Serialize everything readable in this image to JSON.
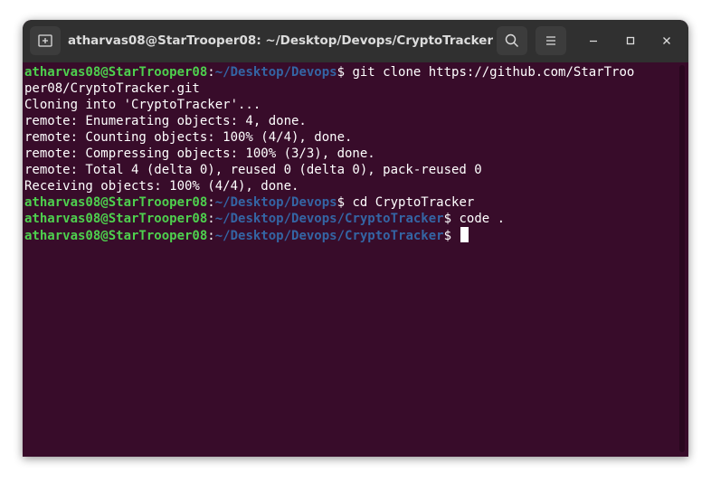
{
  "window": {
    "title": "atharvas08@StarTrooper08: ~/Desktop/Devops/CryptoTracker"
  },
  "icons": {
    "new_tab": "new-tab-icon",
    "search": "search-icon",
    "menu": "hamburger-menu-icon",
    "minimize": "minimize-icon",
    "maximize": "maximize-icon",
    "close": "close-icon"
  },
  "colors": {
    "background": "#380c2a",
    "titlebar": "#303030",
    "prompt_user": "#4ed04e",
    "prompt_path": "#3465a4",
    "text": "#ffffff"
  },
  "terminal": {
    "prompt_user": "atharvas08@StarTrooper08",
    "prompt_sep": ":",
    "lines": [
      {
        "type": "prompt",
        "path": "~/Desktop/Devops",
        "command": "git clone https://github.com/StarTroo"
      },
      {
        "type": "output",
        "text": "per08/CryptoTracker.git"
      },
      {
        "type": "output",
        "text": "Cloning into 'CryptoTracker'..."
      },
      {
        "type": "output",
        "text": "remote: Enumerating objects: 4, done."
      },
      {
        "type": "output",
        "text": "remote: Counting objects: 100% (4/4), done."
      },
      {
        "type": "output",
        "text": "remote: Compressing objects: 100% (3/3), done."
      },
      {
        "type": "output",
        "text": "remote: Total 4 (delta 0), reused 0 (delta 0), pack-reused 0"
      },
      {
        "type": "output",
        "text": "Receiving objects: 100% (4/4), done."
      },
      {
        "type": "prompt",
        "path": "~/Desktop/Devops",
        "command": "cd CryptoTracker"
      },
      {
        "type": "prompt",
        "path": "~/Desktop/Devops/CryptoTracker",
        "command": "code ."
      },
      {
        "type": "prompt",
        "path": "~/Desktop/Devops/CryptoTracker",
        "command": "",
        "cursor": true
      }
    ]
  }
}
